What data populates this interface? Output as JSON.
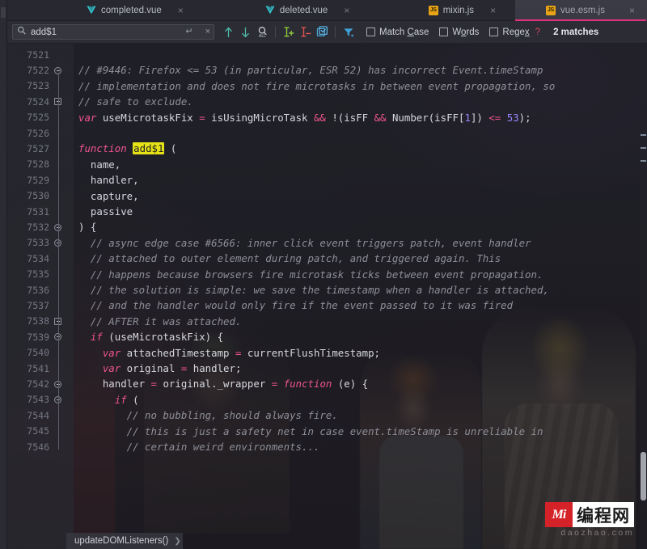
{
  "window": {
    "app": "JetBrains IDE editor",
    "accent_pink": "#e0317b",
    "highlight_yellow": "#e5e218"
  },
  "tabs": [
    {
      "label": "completed.vue",
      "icon": "vue-icon",
      "active": false,
      "close": "×"
    },
    {
      "label": "deleted.vue",
      "icon": "vue-icon",
      "active": false,
      "close": "×"
    },
    {
      "label": "mixin.js",
      "icon": "js-icon",
      "active": false,
      "close": "×"
    },
    {
      "label": "vue.esm.js",
      "icon": "js-icon",
      "active": true,
      "close": "×"
    }
  ],
  "find_toolbar": {
    "search_value": "add$1",
    "search_placeholder": "Search",
    "search_icon": "search-icon",
    "enter_icon": "↵",
    "clear_icon": "×",
    "buttons": [
      {
        "name": "find-previous-button",
        "icon": "arrow-up-icon"
      },
      {
        "name": "find-next-button",
        "icon": "arrow-down-icon"
      },
      {
        "name": "select-all-occurrences-button",
        "icon": "magnifier-all-icon"
      },
      {
        "name": "add-selection-next-occurrence-button",
        "icon": "add-cursor-icon"
      },
      {
        "name": "remove-occurrence-button",
        "icon": "remove-cursor-icon"
      },
      {
        "name": "select-all-button",
        "icon": "checkbox-select-all-icon"
      },
      {
        "name": "filter-button",
        "icon": "filter-funnel-icon"
      }
    ],
    "options": [
      {
        "label_pre": "Match ",
        "label_mnemonic": "C",
        "label_post": "ase",
        "checked": false
      },
      {
        "label_pre": "W",
        "label_mnemonic": "o",
        "label_post": "rds",
        "checked": false
      },
      {
        "label_pre": "Rege",
        "label_mnemonic": "x",
        "label_post": "",
        "checked": false
      }
    ],
    "help_icon": "?",
    "match_count": "2 matches"
  },
  "editor": {
    "first_line_number": 7521,
    "lines": [
      {
        "n": "7521",
        "fold": "",
        "tokens": []
      },
      {
        "n": "7522",
        "fold": "start",
        "tokens": [
          {
            "t": "cmt",
            "s": "// #9446: Firefox <= 53 (in particular, ESR 52) has incorrect Event.timeStamp"
          }
        ]
      },
      {
        "n": "7523",
        "fold": "",
        "tokens": [
          {
            "t": "cmt",
            "s": "// implementation and does not fire microtasks in between event propagation, so"
          }
        ]
      },
      {
        "n": "7524",
        "fold": "end",
        "tokens": [
          {
            "t": "cmt",
            "s": "// safe to exclude."
          }
        ]
      },
      {
        "n": "7525",
        "fold": "",
        "tokens": [
          {
            "t": "kw",
            "s": "var"
          },
          {
            "t": "pl",
            "s": " useMicrotaskFix "
          },
          {
            "t": "op",
            "s": "="
          },
          {
            "t": "pl",
            "s": " isUsingMicroTask "
          },
          {
            "t": "op",
            "s": "&&"
          },
          {
            "t": "pl",
            "s": " !(isFF "
          },
          {
            "t": "op",
            "s": "&&"
          },
          {
            "t": "pl",
            "s": " Number(isFF["
          },
          {
            "t": "num",
            "s": "1"
          },
          {
            "t": "pl",
            "s": "]) "
          },
          {
            "t": "op",
            "s": "<="
          },
          {
            "t": "pl",
            "s": " "
          },
          {
            "t": "num",
            "s": "53"
          },
          {
            "t": "pl",
            "s": ");"
          }
        ]
      },
      {
        "n": "7526",
        "fold": "",
        "tokens": []
      },
      {
        "n": "7527",
        "fold": "",
        "tokens": [
          {
            "t": "kw",
            "s": "function"
          },
          {
            "t": "pl",
            "s": " "
          },
          {
            "t": "hl",
            "s": "add$1"
          },
          {
            "t": "pl",
            "s": " ("
          }
        ]
      },
      {
        "n": "7528",
        "fold": "",
        "tokens": [
          {
            "t": "pl",
            "s": "  name,"
          }
        ]
      },
      {
        "n": "7529",
        "fold": "",
        "tokens": [
          {
            "t": "pl",
            "s": "  handler,"
          }
        ]
      },
      {
        "n": "7530",
        "fold": "",
        "tokens": [
          {
            "t": "pl",
            "s": "  capture,"
          }
        ]
      },
      {
        "n": "7531",
        "fold": "",
        "tokens": [
          {
            "t": "pl",
            "s": "  passive"
          }
        ]
      },
      {
        "n": "7532",
        "fold": "mid",
        "tokens": [
          {
            "t": "pl",
            "s": ") {"
          }
        ]
      },
      {
        "n": "7533",
        "fold": "start",
        "tokens": [
          {
            "t": "cmt",
            "s": "  // async edge case #6566: inner click event triggers patch, event handler"
          }
        ]
      },
      {
        "n": "7534",
        "fold": "",
        "tokens": [
          {
            "t": "cmt",
            "s": "  // attached to outer element during patch, and triggered again. This"
          }
        ]
      },
      {
        "n": "7535",
        "fold": "",
        "tokens": [
          {
            "t": "cmt",
            "s": "  // happens because browsers fire microtask ticks between event propagation."
          }
        ]
      },
      {
        "n": "7536",
        "fold": "",
        "tokens": [
          {
            "t": "cmt",
            "s": "  // the solution is simple: we save the timestamp when a handler is attached,"
          }
        ]
      },
      {
        "n": "7537",
        "fold": "",
        "tokens": [
          {
            "t": "cmt",
            "s": "  // and the handler would only fire if the event passed to it was fired"
          }
        ]
      },
      {
        "n": "7538",
        "fold": "end",
        "tokens": [
          {
            "t": "cmt",
            "s": "  // AFTER it was attached."
          }
        ]
      },
      {
        "n": "7539",
        "fold": "start",
        "tokens": [
          {
            "t": "kw",
            "s": "  if"
          },
          {
            "t": "pl",
            "s": " (useMicrotaskFix) {"
          }
        ]
      },
      {
        "n": "7540",
        "fold": "",
        "tokens": [
          {
            "t": "kw",
            "s": "    var"
          },
          {
            "t": "pl",
            "s": " attachedTimestamp "
          },
          {
            "t": "op",
            "s": "="
          },
          {
            "t": "pl",
            "s": " currentFlushTimestamp;"
          }
        ]
      },
      {
        "n": "7541",
        "fold": "",
        "tokens": [
          {
            "t": "kw",
            "s": "    var"
          },
          {
            "t": "pl",
            "s": " original "
          },
          {
            "t": "op",
            "s": "="
          },
          {
            "t": "pl",
            "s": " handler;"
          }
        ]
      },
      {
        "n": "7542",
        "fold": "start",
        "tokens": [
          {
            "t": "pl",
            "s": "    handler "
          },
          {
            "t": "op",
            "s": "="
          },
          {
            "t": "pl",
            "s": " original._wrapper "
          },
          {
            "t": "op",
            "s": "="
          },
          {
            "t": "pl",
            "s": " "
          },
          {
            "t": "kw",
            "s": "function"
          },
          {
            "t": "pl",
            "s": " (e) {"
          }
        ]
      },
      {
        "n": "7543",
        "fold": "start",
        "tokens": [
          {
            "t": "kw",
            "s": "      if"
          },
          {
            "t": "pl",
            "s": " ("
          }
        ]
      },
      {
        "n": "7544",
        "fold": "",
        "tokens": [
          {
            "t": "cmt",
            "s": "        // no bubbling, should always fire."
          }
        ]
      },
      {
        "n": "7545",
        "fold": "",
        "tokens": [
          {
            "t": "cmt",
            "s": "        // this is just a safety net in case event.timeStamp is unreliable in"
          }
        ]
      },
      {
        "n": "7546",
        "fold": "",
        "tokens": [
          {
            "t": "cmt",
            "s": "        // certain weird environments..."
          }
        ]
      }
    ]
  },
  "breadcrumb": {
    "item": "updateDOMListeners()",
    "chevron": "❯"
  },
  "watermark": {
    "logo_text": "Mi",
    "cn_text": "编程网",
    "domain": "daozhao.com"
  }
}
